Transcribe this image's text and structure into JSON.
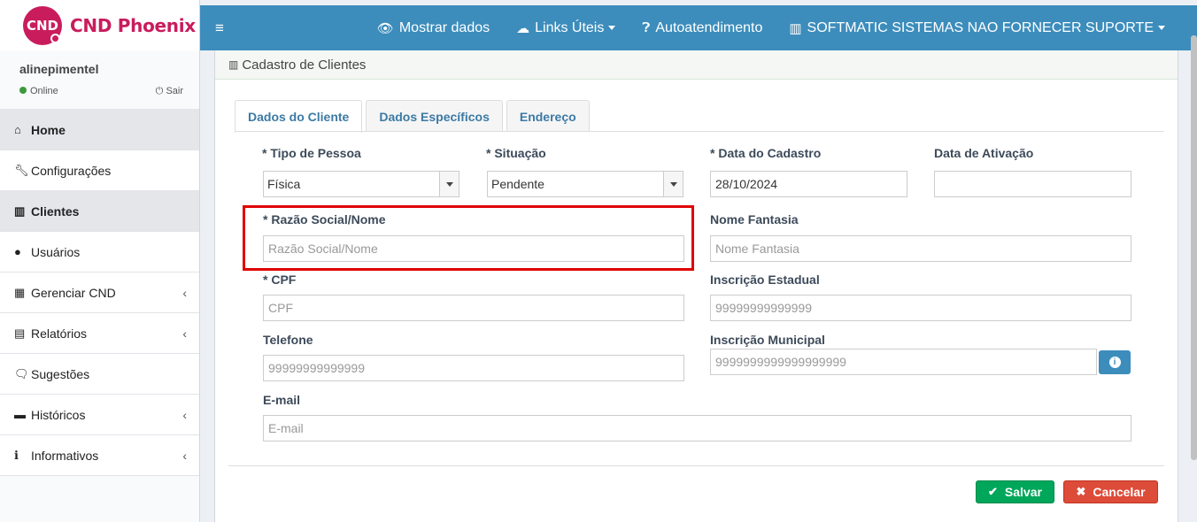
{
  "brand": {
    "badge": "CND",
    "name": "CND Phoenix",
    "color": "#c91c5d"
  },
  "user": {
    "name": "alinepimentel",
    "status": "Online",
    "logout": "Sair"
  },
  "menu": [
    {
      "label": "Home",
      "icon": "home-icon"
    },
    {
      "label": "Configurações",
      "icon": "wrench-icon"
    },
    {
      "label": "Clientes",
      "icon": "building-icon"
    },
    {
      "label": "Usuários",
      "icon": "user-icon"
    },
    {
      "label": "Gerenciar CND",
      "icon": "calendar-icon"
    },
    {
      "label": "Relatórios",
      "icon": "file-icon"
    },
    {
      "label": "Sugestões",
      "icon": "comments-icon"
    },
    {
      "label": "Históricos",
      "icon": "archive-icon"
    },
    {
      "label": "Informativos",
      "icon": "info-circle-icon"
    }
  ],
  "topbar": {
    "mostrar_dados": "Mostrar dados",
    "links_uteis": "Links Úteis",
    "autoatendimento": "Autoatendimento",
    "company": "SOFTMATIC SISTEMAS NAO FORNECER SUPORTE",
    "accent": "#3c8dbc"
  },
  "page": {
    "title": "Cadastro de Clientes"
  },
  "tabs": [
    "Dados do Cliente",
    "Dados Específicos",
    "Endereço"
  ],
  "form": {
    "tipo_pessoa": {
      "label": "* Tipo de Pessoa",
      "value": "Física"
    },
    "situacao": {
      "label": "* Situação",
      "value": "Pendente"
    },
    "data_cadastro": {
      "label": "* Data do Cadastro",
      "value": "28/10/2024"
    },
    "data_ativacao": {
      "label": "Data de Ativação",
      "value": ""
    },
    "razao_social": {
      "label": "* Razão Social/Nome",
      "placeholder": "Razão Social/Nome"
    },
    "nome_fantasia": {
      "label": "Nome Fantasia",
      "placeholder": "Nome Fantasia"
    },
    "cpf": {
      "label": "* CPF",
      "placeholder": "CPF"
    },
    "inscricao_estadual": {
      "label": "Inscrição Estadual",
      "placeholder": "99999999999999"
    },
    "telefone": {
      "label": "Telefone",
      "placeholder": "99999999999999"
    },
    "inscricao_municipal": {
      "label": "Inscrição Municipal",
      "placeholder": "9999999999999999999"
    },
    "email": {
      "label": "E-mail",
      "placeholder": "E-mail"
    }
  },
  "buttons": {
    "save": "Salvar",
    "cancel": "Cancelar"
  }
}
